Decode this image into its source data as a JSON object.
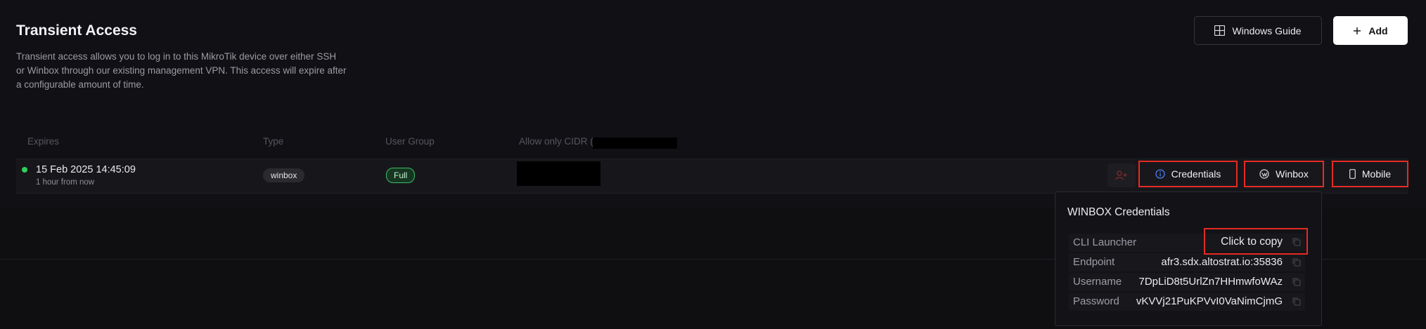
{
  "header": {
    "title": "Transient Access",
    "description": "Transient access allows you to log in to this MikroTik device over either SSH or Winbox through our existing management VPN. This access will expire after a configurable amount of time.",
    "guide_button": "Windows Guide",
    "add_button": "Add"
  },
  "table": {
    "columns": [
      "Expires",
      "Type",
      "User Group",
      "Allow only CIDR ("
    ],
    "rows": [
      {
        "expires": "15 Feb 2025 14:45:09",
        "relative": "1 hour from now",
        "type": "winbox",
        "user_group": "Full",
        "status_color": "#2fd15b"
      }
    ],
    "actions": {
      "credentials": "Credentials",
      "winbox": "Winbox",
      "mobile": "Mobile"
    }
  },
  "popup": {
    "title": "WINBOX Credentials",
    "rows": [
      {
        "label": "CLI Launcher",
        "value": "Click to copy"
      },
      {
        "label": "Endpoint",
        "value": "afr3.sdx.altostrat.io:35836"
      },
      {
        "label": "Username",
        "value": "7DpLiD8t5UrlZn7HHmwfoWAz"
      },
      {
        "label": "Password",
        "value": "vKVVj21PuKPVvI0VaNimCjmG"
      }
    ]
  },
  "colors": {
    "accent_red": "#e52b25",
    "status_green": "#2fd15b",
    "background": "#0f0f12"
  }
}
